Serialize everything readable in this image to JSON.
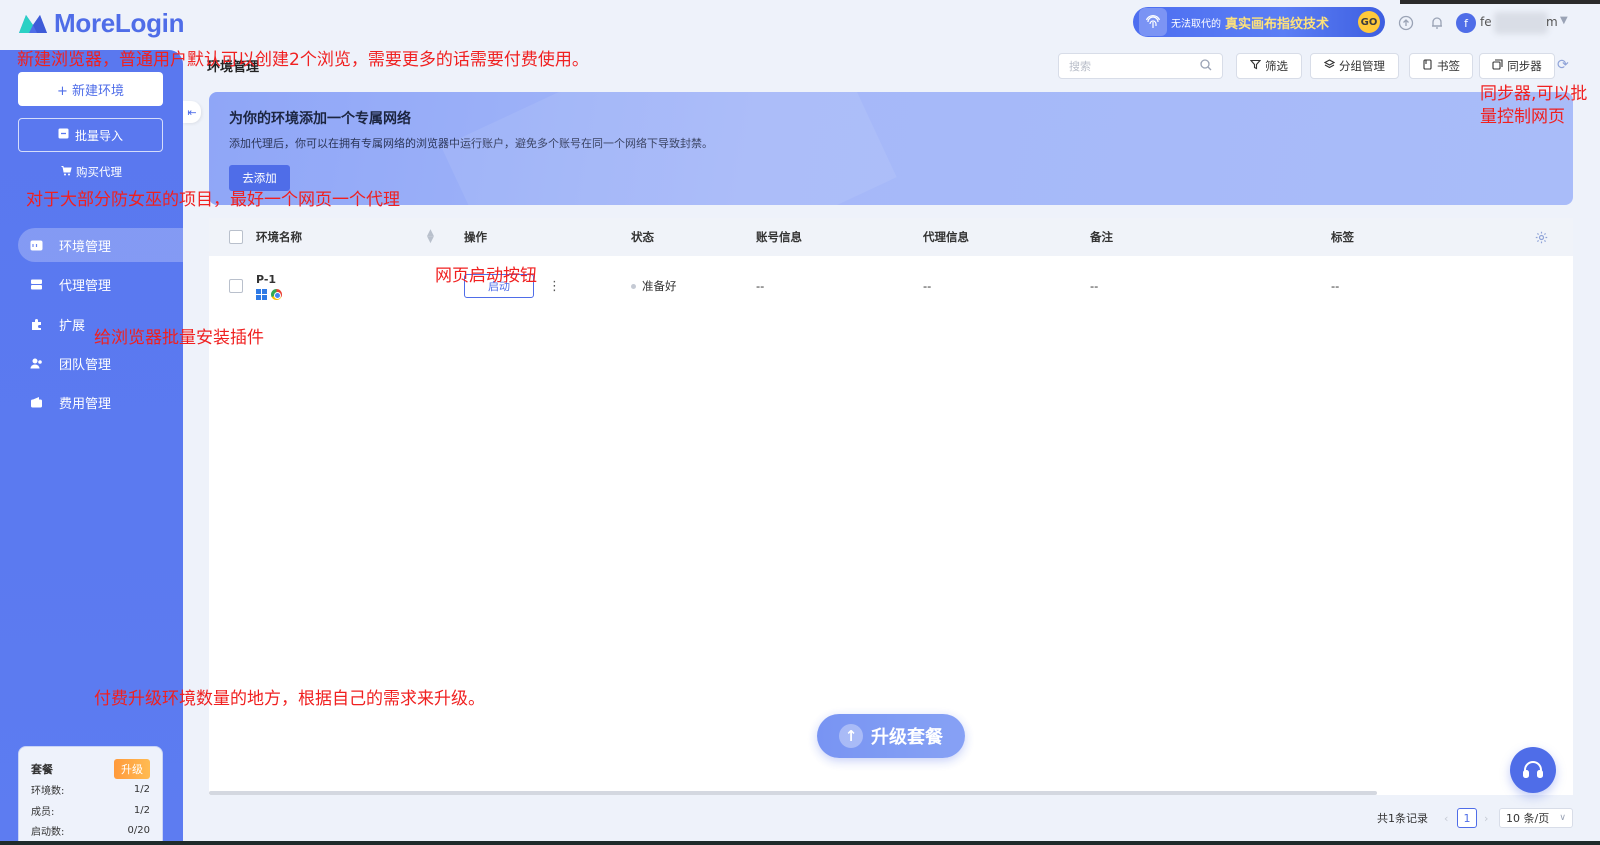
{
  "app": {
    "name": "MoreLogin",
    "brand_color": "#4f6de8"
  },
  "topbar": {
    "promo_small": "无法取代的",
    "promo_big": "真实画布指纹技术",
    "promo_go": "GO",
    "user_initial": "f",
    "user_name": "fe",
    "user_name_suffix": "m",
    "icons": [
      "upload-icon",
      "bell-icon",
      "caret-down-icon"
    ]
  },
  "sidebar": {
    "new_env_label": "+ 新建环境",
    "import_label": "批量导入",
    "buy_proxy_label": "购买代理",
    "items": [
      {
        "label": "环境管理",
        "icon": "browser-icon",
        "active": true
      },
      {
        "label": "代理管理",
        "icon": "server-icon",
        "active": false
      },
      {
        "label": "扩展",
        "icon": "puzzle-icon",
        "active": false
      },
      {
        "label": "团队管理",
        "icon": "team-icon",
        "active": false
      },
      {
        "label": "费用管理",
        "icon": "wallet-icon",
        "active": false
      }
    ],
    "plan": {
      "title": "套餐",
      "upgrade": "升级",
      "rows": [
        {
          "label": "环境数:",
          "value": "1/2"
        },
        {
          "label": "成员:",
          "value": "1/2"
        },
        {
          "label": "启动数:",
          "value": "0/20"
        }
      ]
    }
  },
  "main": {
    "page_title": "环境管理",
    "search_placeholder": "搜索",
    "toolbar": {
      "filter": "筛选",
      "group": "分组管理",
      "bookmarks": "书签",
      "sync": "同步器"
    },
    "banner": {
      "title": "为你的环境添加一个专属网络",
      "desc": "添加代理后，你可以在拥有专属网络的浏览器中运行账户，避免多个账号在同一个网络下导致封禁。",
      "button": "去添加"
    },
    "table": {
      "columns": [
        "环境名称",
        "操作",
        "状态",
        "账号信息",
        "代理信息",
        "备注",
        "标签"
      ],
      "rows": [
        {
          "name": "P-1",
          "action": "启动",
          "status": "准备好",
          "account": "--",
          "proxy": "--",
          "remark": "--",
          "tag": "--"
        }
      ]
    },
    "upgrade_plan": "升级套餐",
    "pagination": {
      "total": "共1条记录",
      "current": "1",
      "page_size": "10 条/页"
    }
  },
  "annotations": {
    "new_browser": "新建浏览器，普通用户默认可以创建2个浏览，需要更多的话需要付费使用。",
    "proxy_tip": "对于大部分防女巫的项目，最好一个网页一个代理",
    "extension_tip": "给浏览器批量安装插件",
    "start_tip": "网页启动按钮",
    "sync_tip_1": "同步器,可以批",
    "sync_tip_2": "量控制网页",
    "upgrade_tip": "付费升级环境数量的地方，根据自己的需求来升级。"
  }
}
